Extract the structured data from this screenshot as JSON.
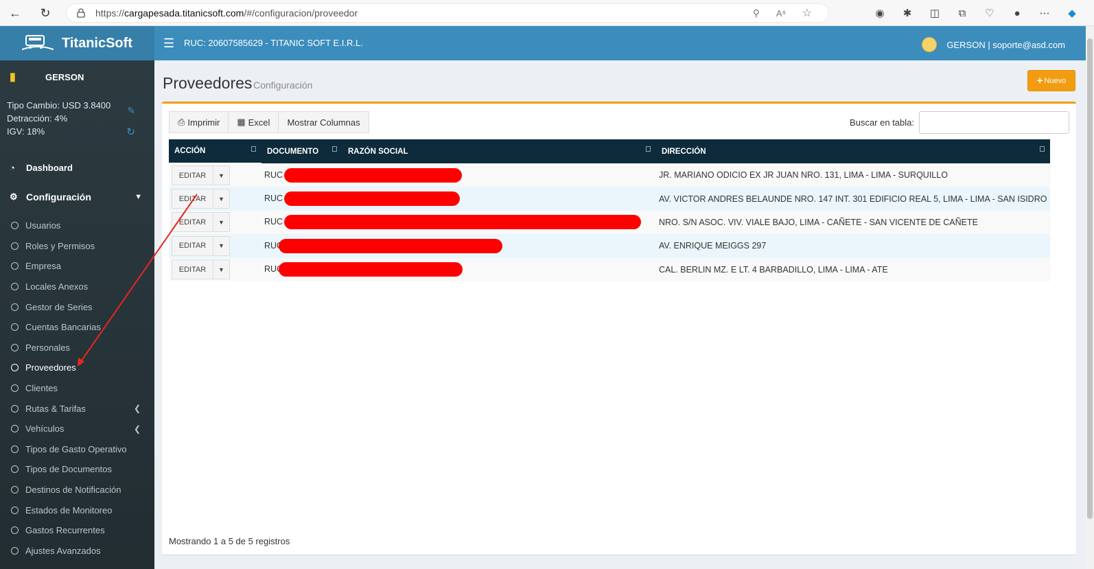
{
  "browser": {
    "url_prefix": "https://",
    "url_host": "cargapesada.titanicsoft.com",
    "url_path": "/#/configuracion/proveedor"
  },
  "header": {
    "brand": "TitanicSoft",
    "company": "RUC: 20607585629 - TITANIC SOFT E.I.R.L.",
    "user": "GERSON | soporte@asd.com"
  },
  "sidebar": {
    "user_name": "GERSON",
    "rates": {
      "tipo_cambio": "Tipo Cambio: USD 3.8400",
      "detraccion": "Detracción: 4%",
      "igv": "IGV: 18%"
    },
    "dashboard": "Dashboard",
    "configuracion": "Configuración",
    "items": [
      {
        "label": "Usuarios"
      },
      {
        "label": "Roles y Permisos"
      },
      {
        "label": "Empresa"
      },
      {
        "label": "Locales Anexos"
      },
      {
        "label": "Gestor de Series"
      },
      {
        "label": "Cuentas Bancarias"
      },
      {
        "label": "Personales"
      },
      {
        "label": "Proveedores"
      },
      {
        "label": "Clientes"
      },
      {
        "label": "Rutas & Tarifas"
      },
      {
        "label": "Vehículos"
      },
      {
        "label": "Tipos de Gasto Operativo"
      },
      {
        "label": "Tipos de Documentos"
      },
      {
        "label": "Destinos de Notificación"
      },
      {
        "label": "Estados de Monitoreo"
      },
      {
        "label": "Gastos Recurrentes"
      },
      {
        "label": "Ajustes Avanzados"
      }
    ]
  },
  "page": {
    "title": "Proveedores",
    "subtitle": "Configuración",
    "new_button": "Nuevo"
  },
  "toolbar": {
    "print": "Imprimir",
    "excel": "Excel",
    "columns": "Mostrar Columnas",
    "search_label": "Buscar en tabla:"
  },
  "table": {
    "headers": [
      "ACCIÓN",
      "DOCUMENTO",
      "RAZÓN SOCIAL",
      "DIRECCIÓN"
    ],
    "edit_label": "EDITAR",
    "rows": [
      {
        "doc": "RUC",
        "direccion": "JR. MARIANO ODICIO EX JR JUAN NRO. 131, LIMA - LIMA - SURQUILLO"
      },
      {
        "doc": "RUC",
        "direccion": "AV. VICTOR ANDRES BELAUNDE NRO. 147 INT. 301 EDIFICIO REAL 5, LIMA - LIMA - SAN ISIDRO"
      },
      {
        "doc": "RUC",
        "direccion": "NRO. S/N ASOC. VIV. VIALE BAJO, LIMA - CAÑETE - SAN VICENTE DE CAÑETE"
      },
      {
        "doc": "RUC",
        "direccion": "AV. ENRIQUE MEIGGS 297"
      },
      {
        "doc": "RUC",
        "direccion": "CAL. BERLIN MZ. E LT. 4 BARBADILLO, LIMA - LIMA - ATE"
      }
    ],
    "footer": "Mostrando 1 a 5 de 5 registros"
  },
  "colors": {
    "header_blue": "#3c8dbc",
    "accent_orange": "#f39c12",
    "sidebar_dark": "#222d32",
    "table_header": "#0d2b3a",
    "redaction": "#ff0000"
  }
}
